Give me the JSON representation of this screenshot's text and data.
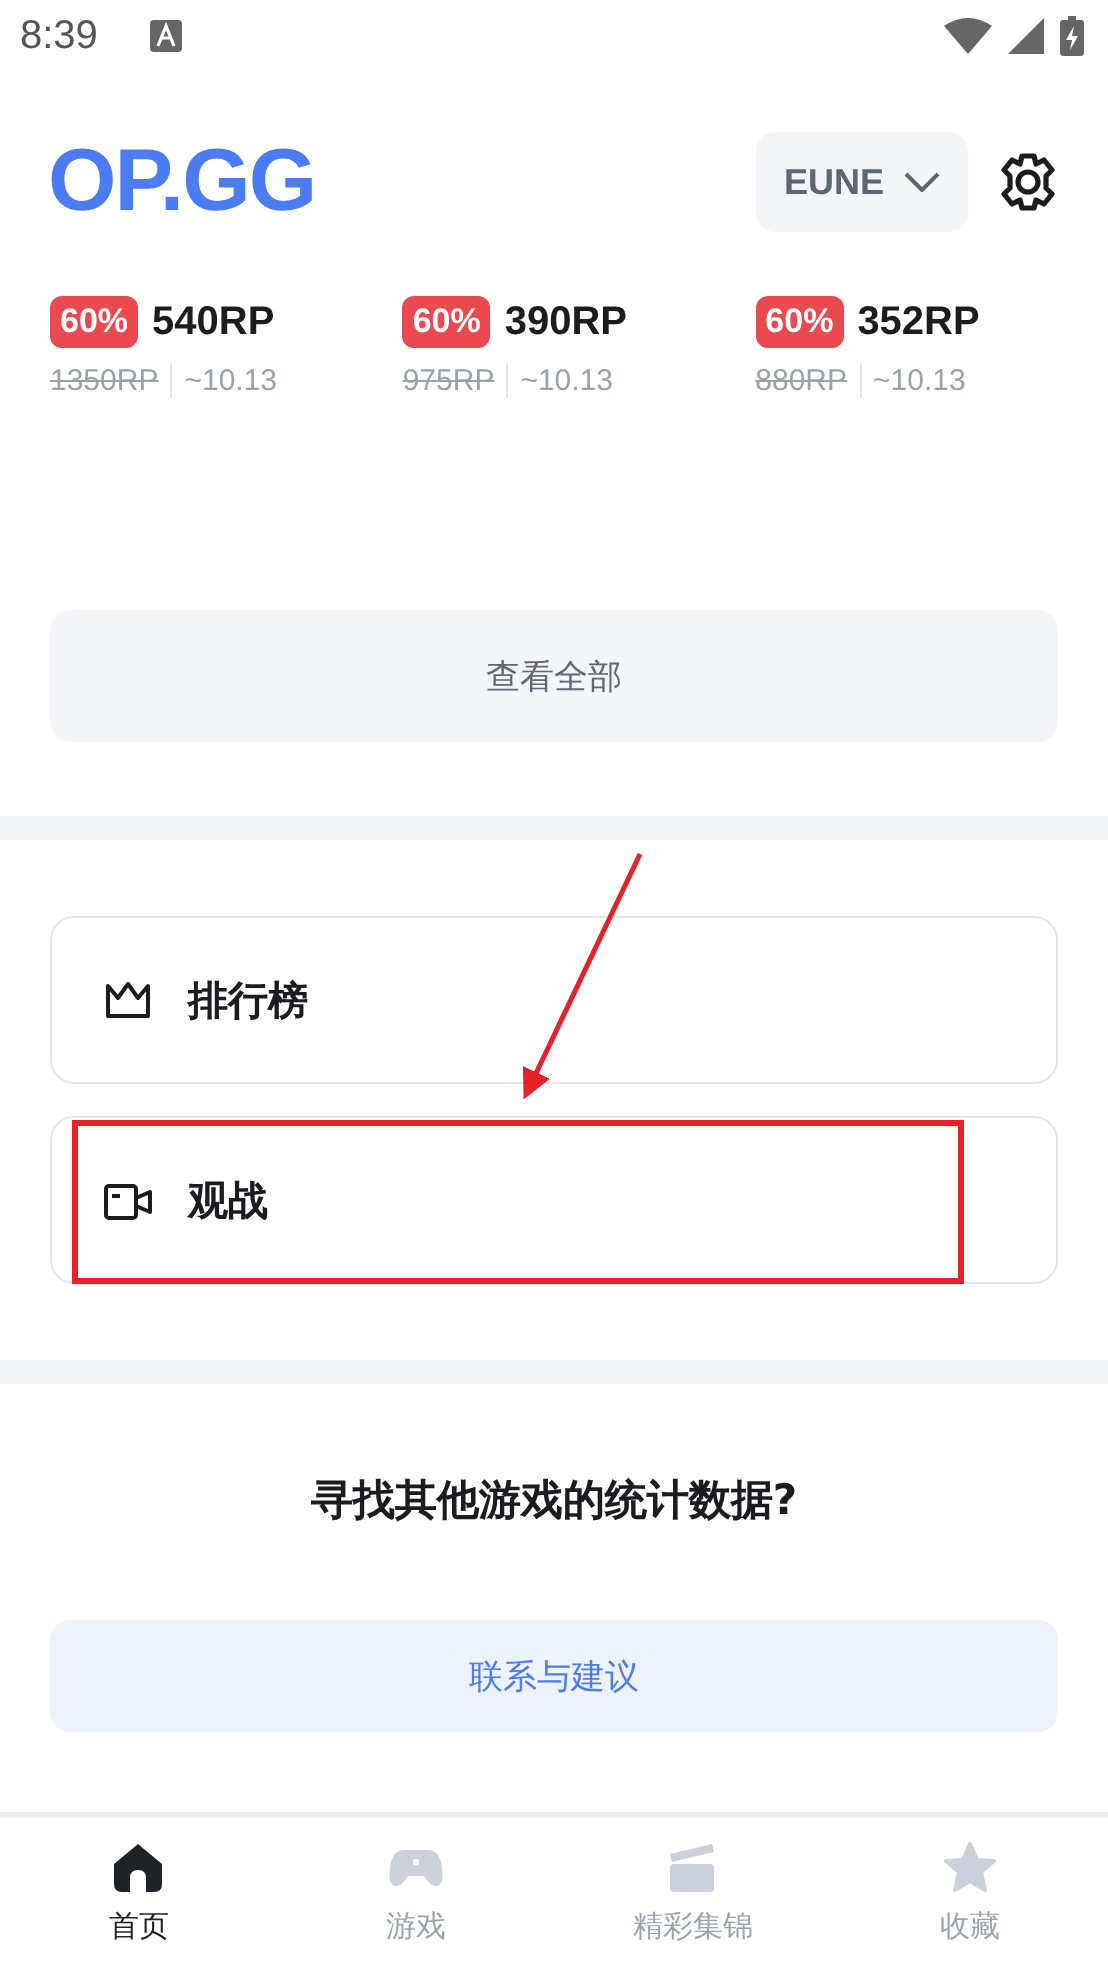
{
  "status_bar": {
    "time": "8:39"
  },
  "header": {
    "logo": "OP.GG",
    "region": "EUNE"
  },
  "offers": [
    {
      "discount": "60%",
      "price": "540RP",
      "original_price": "1350RP",
      "until": "~10.13"
    },
    {
      "discount": "60%",
      "price": "390RP",
      "original_price": "975RP",
      "until": "~10.13"
    },
    {
      "discount": "60%",
      "price": "352RP",
      "original_price": "880RP",
      "until": "~10.13"
    }
  ],
  "view_all": "查看全部",
  "menu": [
    {
      "kind": "crown",
      "label": "排行榜",
      "highlighted": false
    },
    {
      "kind": "camera",
      "label": "观战",
      "highlighted": true
    }
  ],
  "other_games": {
    "title": "寻找其他游戏的统计数据?",
    "button": "联系与建议"
  },
  "bottom_nav": [
    {
      "kind": "home",
      "label": "首页",
      "selected": true
    },
    {
      "kind": "gamepad",
      "label": "游戏",
      "selected": false
    },
    {
      "kind": "clapper",
      "label": "精彩集锦",
      "selected": false
    },
    {
      "kind": "star",
      "label": "收藏",
      "selected": false
    }
  ]
}
